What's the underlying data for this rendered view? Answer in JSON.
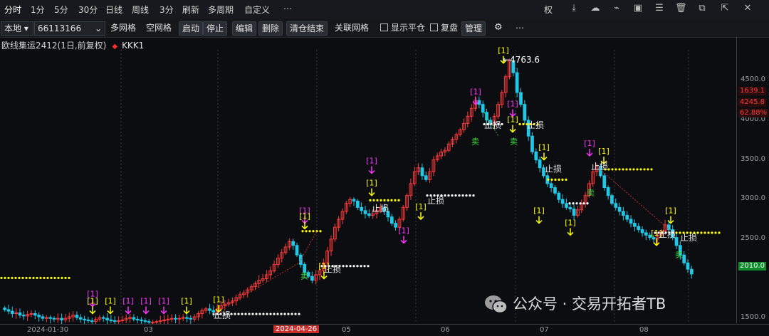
{
  "toolbar": {
    "periods": [
      {
        "label": "分时",
        "active": true
      },
      {
        "label": "1分",
        "active": false
      },
      {
        "label": "5分",
        "active": false
      },
      {
        "label": "30分",
        "active": false
      },
      {
        "label": "日线",
        "active": false
      },
      {
        "label": "周线",
        "active": false
      },
      {
        "label": "3分",
        "active": false
      },
      {
        "label": "刷新",
        "active": false
      },
      {
        "label": "多周期",
        "active": false
      },
      {
        "label": "自定义",
        "active": false
      }
    ],
    "more_glyph": "⋯",
    "right_label": "权"
  },
  "toolbar2": {
    "source": "本地",
    "account": "66113166",
    "buttons": [
      "多网格",
      "空网格",
      "启动",
      "停止",
      "编辑",
      "删除",
      "清仓结束",
      "关联网格"
    ],
    "check_show_close": "显示平仓",
    "check_review": "复盘",
    "manage": "管理"
  },
  "legend": {
    "symbol": "欧线集运2412(1日,前复权)",
    "indicator": "KKK1"
  },
  "yaxis": {
    "ticks": [
      "4500.0",
      "4000.0",
      "3500.0",
      "3000.0",
      "2500.0",
      "1500.0"
    ],
    "tags": [
      {
        "text": "1639.1",
        "color": "#ff3b3b",
        "bg": "#2b0c0c"
      },
      {
        "text": "4245.8",
        "color": "#ff3b3b",
        "bg": "#2b0c0c"
      },
      {
        "text": "62.88%",
        "color": "#ff3b3b",
        "bg": "#2b0c0c"
      },
      {
        "text": "2010.0",
        "color": "#ffffff",
        "bg": "#0e8a2a"
      }
    ]
  },
  "xaxis": {
    "labels": [
      "2024-01-30",
      "03",
      "2024-04-26",
      "05",
      "06",
      "07",
      "08"
    ],
    "highlight": "2024-04-26"
  },
  "chart_data": {
    "type": "candlestick",
    "title": "欧线集运2412(1日,前复权)",
    "y_unit": "price",
    "ylim": [
      1430,
      5050
    ],
    "high_annotation": "4763.6",
    "price": [
      1610,
      1590,
      1560,
      1570,
      1540,
      1530,
      1550,
      1560,
      1540,
      1520,
      1500,
      1510,
      1500,
      1490,
      1500,
      1480,
      1500,
      1520,
      1540,
      1510,
      1490,
      1480,
      1470,
      1460,
      1490,
      1510,
      1500,
      1480,
      1470,
      1460,
      1470,
      1480,
      1500,
      1510,
      1490,
      1480,
      1470,
      1460,
      1450,
      1450,
      1460,
      1470,
      1480,
      1490,
      1500,
      1490,
      1500,
      1510,
      1500,
      1490,
      1520,
      1560,
      1600,
      1620,
      1600,
      1580,
      1620,
      1660,
      1680,
      1700,
      1720,
      1760,
      1800,
      1820,
      1860,
      1900,
      1940,
      1980,
      2000,
      2050,
      2100,
      2180,
      2260,
      2330,
      2400,
      2470,
      2420,
      2300,
      2180,
      2080,
      2030,
      1980,
      2050,
      2100,
      2200,
      2350,
      2500,
      2650,
      2750,
      2850,
      2950,
      3000,
      2980,
      2900,
      2860,
      2820,
      2800,
      2820,
      2860,
      2900,
      2850,
      2780,
      2700,
      2650,
      2750,
      2900,
      3050,
      3200,
      3350,
      3400,
      3300,
      3250,
      3350,
      3500,
      3550,
      3600,
      3620,
      3700,
      3760,
      3820,
      3880,
      3960,
      4050,
      4150,
      4250,
      4200,
      4100,
      4000,
      3950,
      4050,
      4200,
      4350,
      4550,
      4750,
      4600,
      4350,
      4200,
      4000,
      3800,
      3600,
      3500,
      3400,
      3300,
      3200,
      3150,
      3080,
      3000,
      2950,
      2900,
      2880,
      2800,
      2870,
      2950,
      3050,
      3200,
      3350,
      3420,
      3300,
      3150,
      3050,
      2950,
      2900,
      2850,
      2800,
      2750,
      2700,
      2660,
      2620,
      2580,
      2550,
      2520,
      2500,
      2550,
      2600,
      2680,
      2620,
      2520,
      2420,
      2300,
      2200,
      2120,
      2060
    ],
    "grid": true
  },
  "watermark": "公众号 · 交易开拓者TB",
  "colors": {
    "up": "#ff3b3b",
    "down": "#1ec8e6",
    "background": "#0b0d11",
    "buy_signal": "#ffff00",
    "sell_signal": "#ff33ff",
    "stop_text": "#e6e6e6"
  },
  "signals": {
    "bracket": "[1]",
    "stop": "止损",
    "buy_text": "卖"
  }
}
